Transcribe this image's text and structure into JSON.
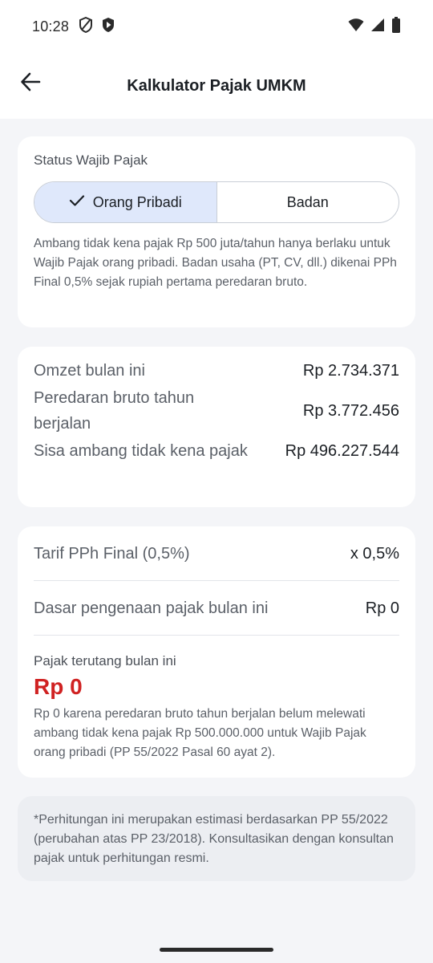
{
  "status_bar": {
    "time": "10:28"
  },
  "app_bar": {
    "title": "Kalkulator Pajak UMKM"
  },
  "taxpayer_status": {
    "label": "Status Wajib Pajak",
    "options": [
      "Orang Pribadi",
      "Badan"
    ],
    "selected": "Orang Pribadi",
    "help": "Ambang tidak kena pajak Rp 500 juta/tahun hanya berlaku untuk Wajib Pajak orang pribadi. Badan usaha (PT, CV, dll.) dikenai PPh Final 0,5% sejak rupiah pertama peredaran bruto."
  },
  "summary": {
    "rows": [
      {
        "label": "Omzet bulan ini",
        "value": "Rp 2.734.371"
      },
      {
        "label": "Peredaran bruto tahun berjalan",
        "value": "Rp 3.772.456"
      },
      {
        "label": "Sisa ambang tidak kena pajak",
        "value": "Rp 496.227.544"
      }
    ]
  },
  "calculation": {
    "rate_label": "Tarif PPh Final (0,5%)",
    "rate_value": "x 0,5%",
    "base_label": "Dasar pengenaan pajak bulan ini",
    "base_value": "Rp 0",
    "tax_label": "Pajak terutang bulan ini",
    "tax_amount": "Rp 0",
    "tax_note": "Rp 0 karena peredaran bruto tahun berjalan belum melewati ambang tidak kena pajak Rp 500.000.000 untuk Wajib Pajak orang pribadi (PP 55/2022 Pasal 60 ayat 2)."
  },
  "disclaimer": "*Perhitungan ini merupakan estimasi berdasarkan PP 55/2022 (perubahan atas PP 23/2018). Konsultasikan dengan konsultan pajak untuk perhitungan resmi.",
  "colors": {
    "accent_selected_bg": "#dfe8fb",
    "tax_amount": "#d02222"
  }
}
